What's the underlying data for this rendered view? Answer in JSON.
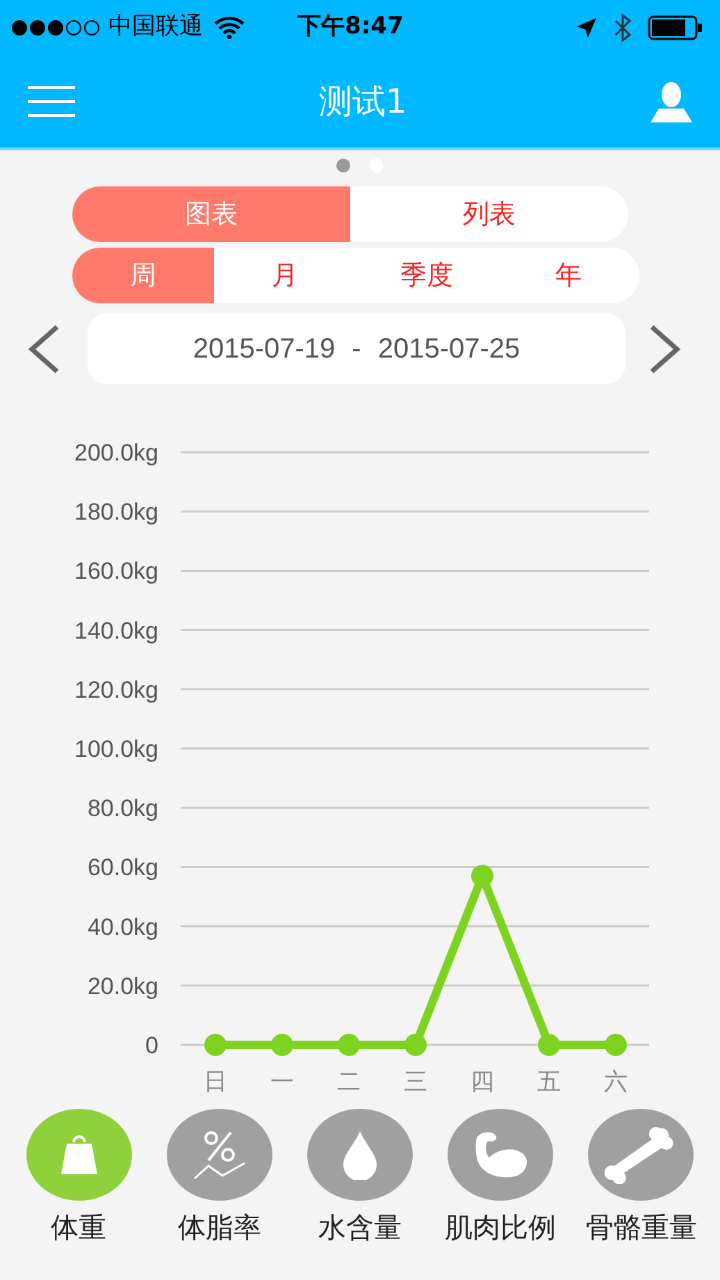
{
  "status_bar": {
    "carrier": "中国联通",
    "time": "下午8:47"
  },
  "nav": {
    "title": "测试1"
  },
  "pages": [
    {
      "selected": true
    },
    {
      "selected": false
    }
  ],
  "view_tabs": [
    {
      "label": "图表",
      "selected": true
    },
    {
      "label": "列表",
      "selected": false
    }
  ],
  "period_tabs": [
    {
      "label": "周",
      "selected": true
    },
    {
      "label": "月",
      "selected": false
    },
    {
      "label": "季度",
      "selected": false
    },
    {
      "label": "年",
      "selected": false
    }
  ],
  "date_range": {
    "start": "2015-07-19",
    "separator": "-",
    "end": "2015-07-25"
  },
  "chart": {
    "chart_data": {
      "type": "line",
      "categories": [
        "日",
        "一",
        "二",
        "三",
        "四",
        "五",
        "六"
      ],
      "series": [
        {
          "color": "#7ed321",
          "marker": "circle",
          "values": [
            0,
            0,
            0,
            0,
            57,
            0,
            0
          ]
        }
      ],
      "grid": true,
      "ylim": [
        0,
        200
      ],
      "yticks": [
        {
          "value": 0,
          "label": "0"
        },
        {
          "value": 20,
          "label": "20.0kg"
        },
        {
          "value": 40,
          "label": "40.0kg"
        },
        {
          "value": 60,
          "label": "60.0kg"
        },
        {
          "value": 80,
          "label": "80.0kg"
        },
        {
          "value": 100,
          "label": "100.0kg"
        },
        {
          "value": 120,
          "label": "120.0kg"
        },
        {
          "value": 140,
          "label": "140.0kg"
        },
        {
          "value": 160,
          "label": "160.0kg"
        },
        {
          "value": 180,
          "label": "180.0kg"
        },
        {
          "value": 200,
          "label": "200.0kg"
        }
      ]
    }
  },
  "metrics": [
    {
      "kind": "weight",
      "label": "体重",
      "selected": true
    },
    {
      "kind": "fat",
      "label": "体脂率",
      "selected": false
    },
    {
      "kind": "water",
      "label": "水含量",
      "selected": false
    },
    {
      "kind": "muscle",
      "label": "肌肉比例",
      "selected": false
    },
    {
      "kind": "bone",
      "label": "骨骼重量",
      "selected": false
    }
  ]
}
